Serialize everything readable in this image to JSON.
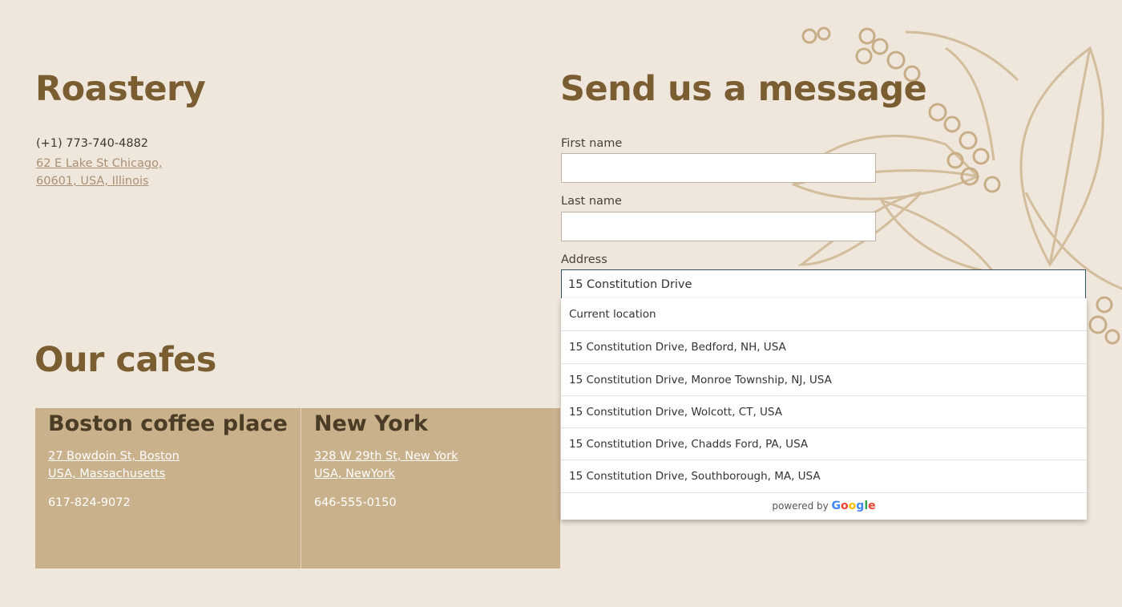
{
  "roastery": {
    "title": "Roastery",
    "phone": "(+1) 773-740-4882",
    "address_line1": "62 E Lake St Chicago,",
    "address_line2": "60601, USA, Illinois"
  },
  "cafes": {
    "title": "Our cafes",
    "items": [
      {
        "name": "Boston coffee place",
        "address_line1": "27 Bowdoin St, Boston",
        "address_line2": "USA, Massachusetts",
        "phone": "617-824-9072"
      },
      {
        "name": "New York",
        "address_line1": "328 W 29th St, New York",
        "address_line2": "USA, NewYork",
        "phone": "646-555-0150"
      }
    ]
  },
  "form": {
    "title": "Send us a message",
    "first_name_label": "First name",
    "first_name_value": "",
    "last_name_label": "Last name",
    "last_name_value": "",
    "address_label": "Address",
    "address_value": "15 Constitution Drive"
  },
  "autocomplete": {
    "items": [
      "Current location",
      "15 Constitution Drive, Bedford, NH, USA",
      "15 Constitution Drive, Monroe Township, NJ, USA",
      "15 Constitution Drive, Wolcott, CT, USA",
      "15 Constitution Drive, Chadds Ford, PA, USA",
      "15 Constitution Drive, Southborough, MA, USA"
    ],
    "powered_by": "powered by",
    "brand_letters": [
      "G",
      "o",
      "o",
      "g",
      "l",
      "e"
    ]
  },
  "colors": {
    "background": "#efe6dc",
    "heading": "#7a5d31",
    "cafe_card": "#c9b18c",
    "decor": "#c8b08a"
  },
  "icons": {
    "decor": "coffee-plant-illustration"
  }
}
